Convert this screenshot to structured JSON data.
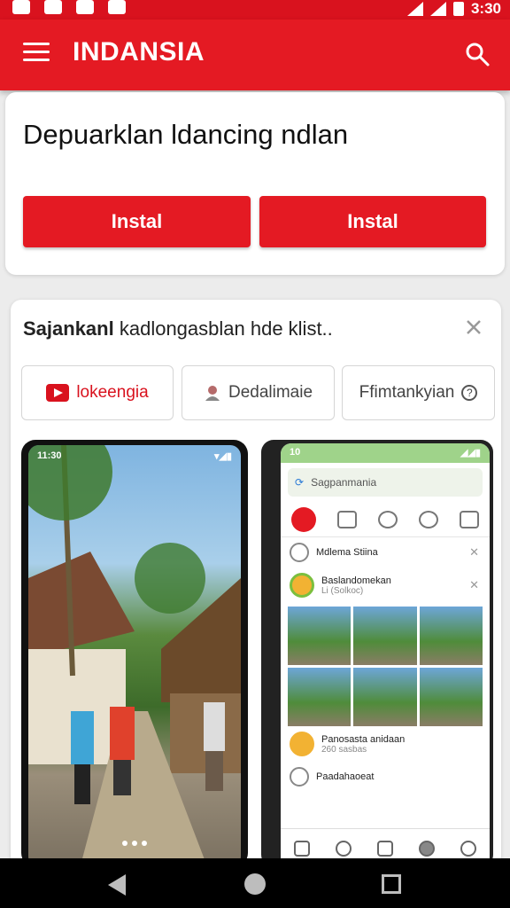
{
  "status_bar": {
    "time": "3:30"
  },
  "app_bar": {
    "title": "INDANSIA"
  },
  "card1": {
    "heading": "Depuarklan ldancing ndlan",
    "install_a": "Instal",
    "install_b": "Instal"
  },
  "card2": {
    "suggestion_prefix": "Sajankanl",
    "suggestion_rest": "kadlongasblan hde klist..",
    "chips": [
      "lokeengia",
      "Dedalimaie",
      "Ffimtankyian"
    ]
  },
  "phone1": {
    "time": "11:30"
  },
  "phone2": {
    "time": "10",
    "search_text": "Sagpanmania",
    "row1": "Mdlema Stiina",
    "row2_title": "Baslandomekan",
    "row2_sub": "Li (Solkoc)",
    "row3_title": "Panosasta anidaan",
    "row3_sub": "260 sasbas",
    "row4_title": "Paadahaoeat"
  },
  "colors": {
    "brand_red": "#e41a23"
  }
}
